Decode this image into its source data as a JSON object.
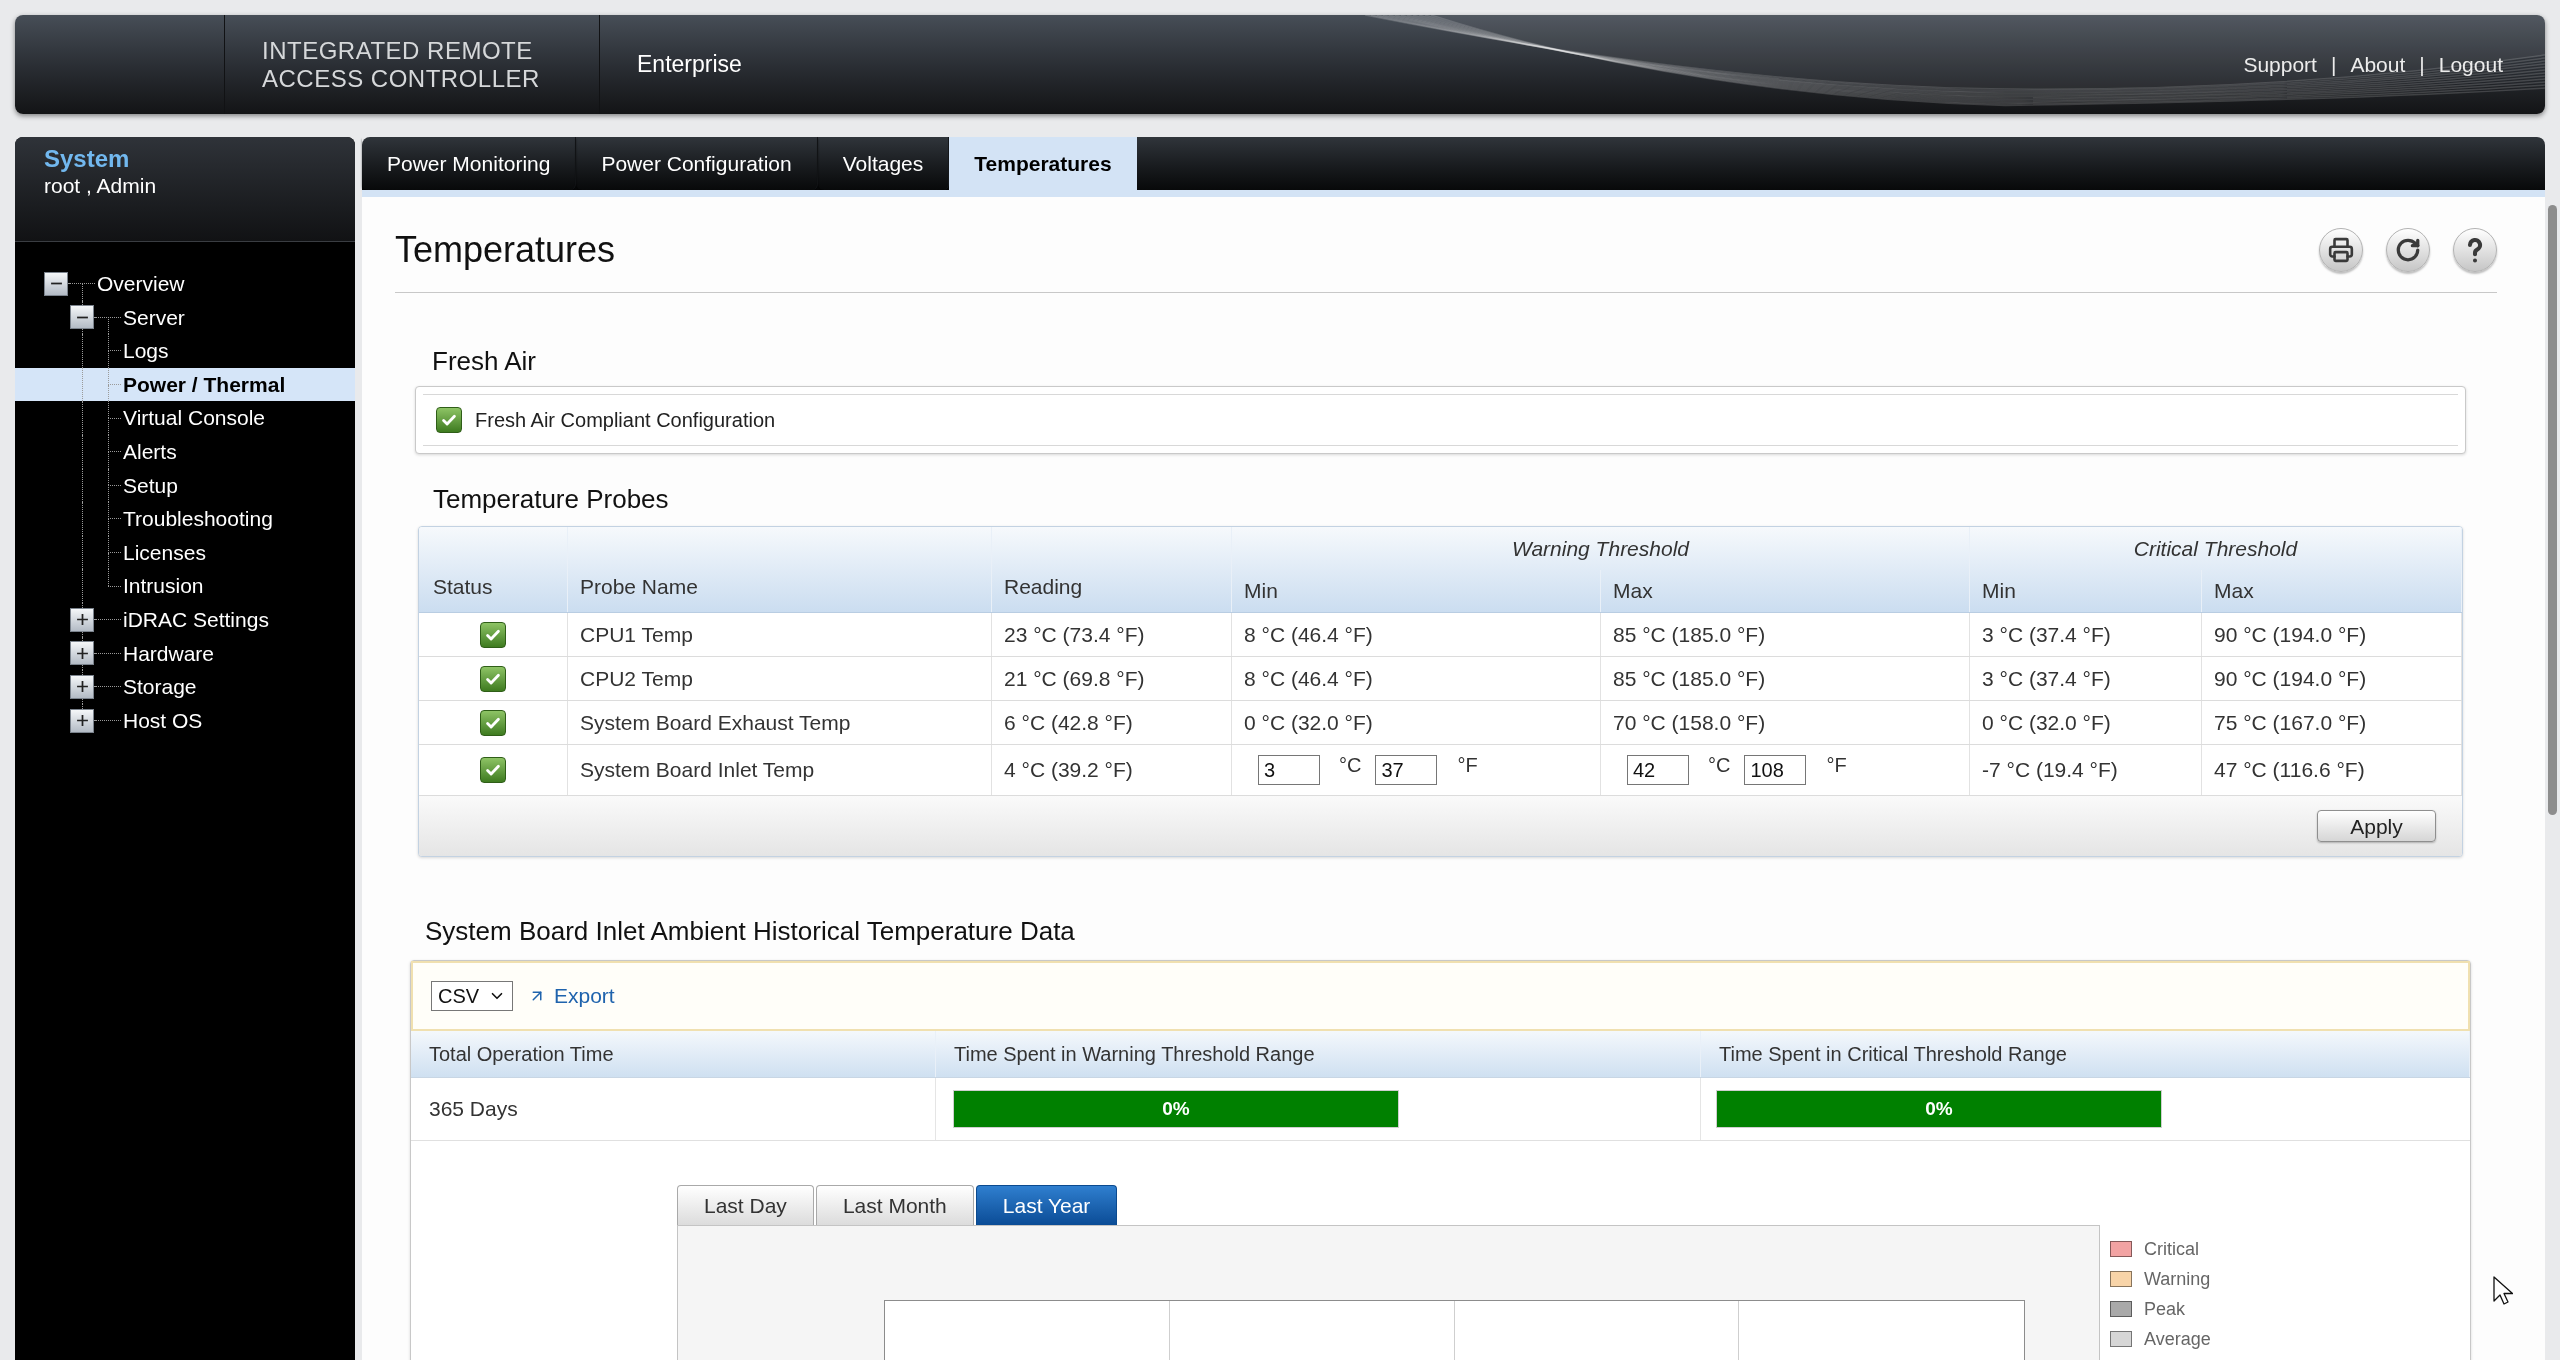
{
  "header": {
    "logo_lines": [
      "INTEGRATED REMOTE",
      "ACCESS CONTROLLER"
    ],
    "edition": "Enterprise",
    "links": [
      "Support",
      "About",
      "Logout"
    ],
    "separators": [
      "|",
      "|"
    ]
  },
  "sidebar": {
    "title": "System",
    "user": "root , Admin",
    "tree": [
      {
        "label": "Overview",
        "expanded": true,
        "selected": false,
        "children": [
          {
            "label": "Server",
            "expanded": true,
            "selected": false,
            "children": [
              {
                "label": "Logs",
                "selected": false
              },
              {
                "label": "Power / Thermal",
                "selected": true
              },
              {
                "label": "Virtual Console",
                "selected": false
              },
              {
                "label": "Alerts",
                "selected": false
              },
              {
                "label": "Setup",
                "selected": false
              },
              {
                "label": "Troubleshooting",
                "selected": false
              },
              {
                "label": "Licenses",
                "selected": false
              },
              {
                "label": "Intrusion",
                "selected": false
              }
            ]
          },
          {
            "label": "iDRAC Settings",
            "expanded": false,
            "selected": false
          },
          {
            "label": "Hardware",
            "expanded": false,
            "selected": false
          },
          {
            "label": "Storage",
            "expanded": false,
            "selected": false
          },
          {
            "label": "Host OS",
            "expanded": false,
            "selected": false
          }
        ]
      }
    ]
  },
  "tabs": [
    {
      "label": "Power Monitoring",
      "selected": false
    },
    {
      "label": "Power Configuration",
      "selected": false
    },
    {
      "label": "Voltages",
      "selected": false
    },
    {
      "label": "Temperatures",
      "selected": true
    }
  ],
  "page": {
    "title": "Temperatures"
  },
  "fresh_air": {
    "heading": "Fresh Air",
    "label": "Fresh Air Compliant Configuration",
    "compliant": true
  },
  "probes": {
    "heading": "Temperature Probes",
    "groups": [
      "Warning Threshold",
      "Critical Threshold"
    ],
    "columns": [
      "Status",
      "Probe Name",
      "Reading",
      "Min",
      "Max",
      "Min",
      "Max"
    ],
    "rows": [
      {
        "healthy": true,
        "name": "CPU1 Temp",
        "reading": "23 °C (73.4 °F)",
        "thresholds": [
          {
            "kind": "text",
            "text": "8 °C (46.4 °F)"
          },
          {
            "kind": "text",
            "text": "85 °C (185.0 °F)"
          },
          {
            "kind": "text",
            "text": "3 °C (37.4 °F)"
          },
          {
            "kind": "text",
            "text": "90 °C (194.0 °F)"
          }
        ]
      },
      {
        "healthy": true,
        "name": "CPU2 Temp",
        "reading": "21 °C (69.8 °F)",
        "thresholds": [
          {
            "kind": "text",
            "text": "8 °C (46.4 °F)"
          },
          {
            "kind": "text",
            "text": "85 °C (185.0 °F)"
          },
          {
            "kind": "text",
            "text": "3 °C (37.4 °F)"
          },
          {
            "kind": "text",
            "text": "90 °C (194.0 °F)"
          }
        ]
      },
      {
        "healthy": true,
        "name": "System Board Exhaust Temp",
        "reading": "6 °C (42.8 °F)",
        "thresholds": [
          {
            "kind": "text",
            "text": "0 °C (32.0 °F)"
          },
          {
            "kind": "text",
            "text": "70 °C (158.0 °F)"
          },
          {
            "kind": "text",
            "text": "0 °C (32.0 °F)"
          },
          {
            "kind": "text",
            "text": "75 °C (167.0 °F)"
          }
        ]
      },
      {
        "healthy": true,
        "name": "System Board Inlet Temp",
        "reading": "4 °C (39.2 °F)",
        "thresholds": [
          {
            "kind": "editable",
            "celsius": "3",
            "celsius_unit": "°C",
            "fahrenheit": "37",
            "fahrenheit_unit": "°F"
          },
          {
            "kind": "editable",
            "celsius": "42",
            "celsius_unit": "°C",
            "fahrenheit": "108",
            "fahrenheit_unit": "°F"
          },
          {
            "kind": "text",
            "text": "-7 °C (19.4 °F)"
          },
          {
            "kind": "text",
            "text": "47 °C (116.6 °F)"
          }
        ]
      }
    ],
    "apply": "Apply"
  },
  "history": {
    "heading": "System Board Inlet Ambient Historical Temperature Data",
    "format": "CSV",
    "export": "Export",
    "columns": [
      "Total Operation Time",
      "Time Spent in Warning Threshold Range",
      "Time Spent in Critical Threshold Range"
    ],
    "total_time": "365 Days",
    "warning_time": "0%",
    "critical_time": "0%",
    "ranges": [
      {
        "label": "Last Day",
        "selected": false
      },
      {
        "label": "Last Month",
        "selected": false
      },
      {
        "label": "Last Year",
        "selected": true
      }
    ],
    "legend": [
      {
        "label": "Critical",
        "color": "#f2a3a3"
      },
      {
        "label": "Warning",
        "color": "#f8d4a8"
      },
      {
        "label": "Peak",
        "color": "#a9a9a9"
      },
      {
        "label": "Average",
        "color": "#d6d6d6"
      }
    ]
  }
}
